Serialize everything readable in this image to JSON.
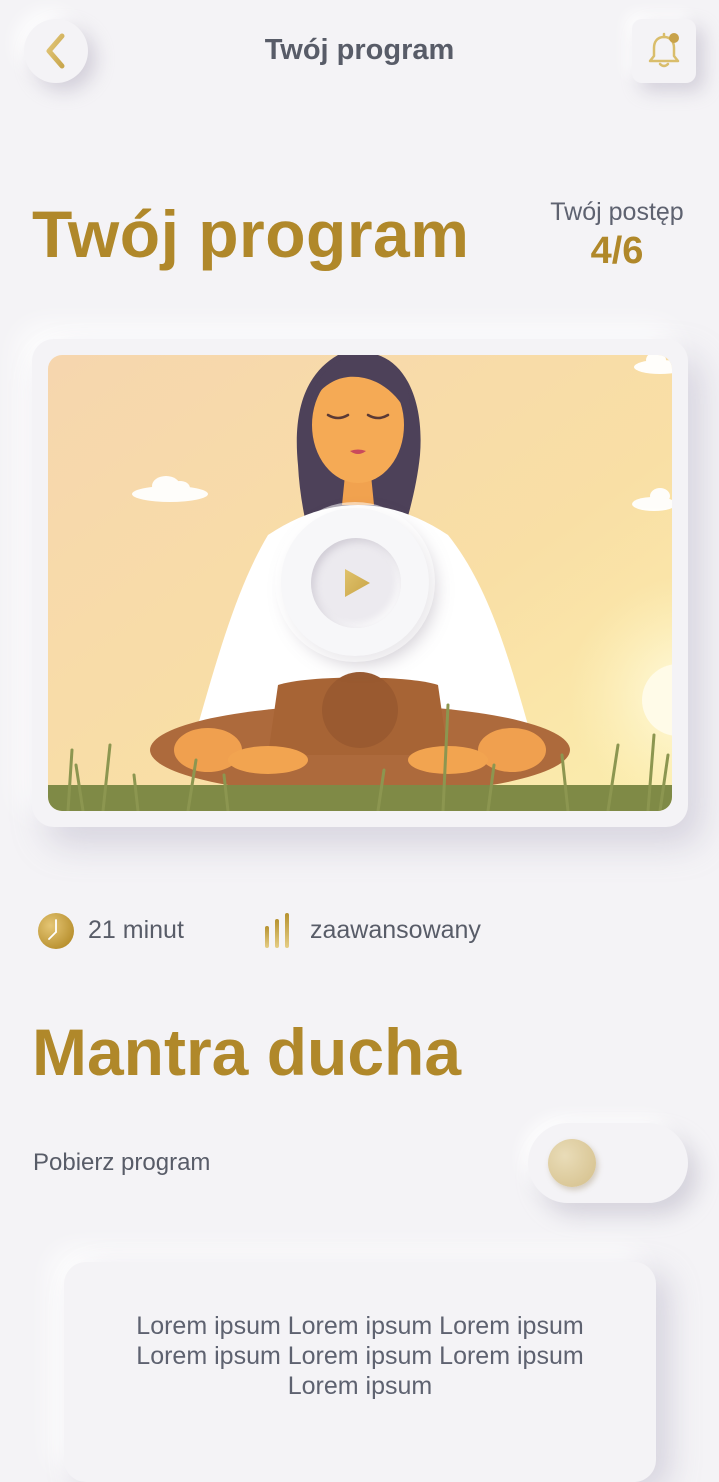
{
  "header": {
    "title": "Twój program",
    "back_icon": "chevron-left-icon",
    "notification_icon": "bell-icon",
    "notification_dot": true
  },
  "program": {
    "title": "Twój program",
    "progress_label": "Twój postęp",
    "progress_value": "4/6"
  },
  "video": {
    "illustration": "woman-meditating-in-lotus-pose",
    "play_icon": "play-icon"
  },
  "meta": {
    "duration_icon": "clock-icon",
    "duration": "21 minut",
    "level_icon": "level-bars-icon",
    "level": "zaawansowany"
  },
  "section": {
    "title": "Mantra ducha"
  },
  "download": {
    "label": "Pobierz program",
    "enabled": false
  },
  "description": {
    "text": "Lorem ipsum Lorem ipsum Lorem ipsum Lorem ipsum Lorem ipsum Lorem ipsum Lorem ipsum"
  },
  "colors": {
    "accent": "#b0882a",
    "background": "#f4f3f6",
    "text": "#585c68"
  }
}
